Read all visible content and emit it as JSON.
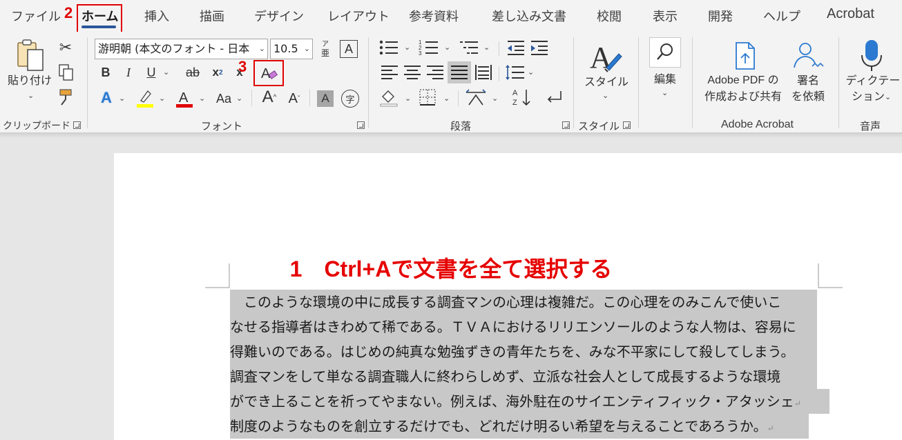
{
  "tabs": [
    "ファイル",
    "ホーム",
    "挿入",
    "描画",
    "デザイン",
    "レイアウト",
    "参考資料",
    "差し込み文書",
    "校閲",
    "表示",
    "開発",
    "ヘルプ",
    "Acrobat"
  ],
  "annotations": {
    "step1": "1　Ctrl+Aで文書を全て選択する",
    "step2": "2",
    "step3": "3"
  },
  "clipboard": {
    "paste_label": "貼り付け",
    "group_label": "クリップボード"
  },
  "font": {
    "name_value": "游明朝 (本文のフォント - 日本",
    "size_value": "10.5",
    "bold": "B",
    "italic": "I",
    "underline": "U",
    "strike": "ab",
    "subscript": "x",
    "superscript": "x",
    "change_case": "Aa",
    "grow": "A",
    "shrink": "A",
    "group_label": "フォント",
    "phonetic_top": "ア",
    "phonetic_bottom": "亜",
    "enclose": "字"
  },
  "paragraph": {
    "group_label": "段落"
  },
  "styles": {
    "label": "スタイル",
    "group_label": "スタイル"
  },
  "editing": {
    "label": "編集"
  },
  "acrobat": {
    "create_share_line1": "Adobe PDF の",
    "create_share_line2": "作成および共有",
    "sign_line1": "署名",
    "sign_line2": "を依頼",
    "group_label": "Adobe Acrobat"
  },
  "voice": {
    "dictate_line1": "ディクテー",
    "dictate_line2": "ション",
    "group_label": "音声"
  },
  "document": {
    "lines": [
      "　このような環境の中に成長する調査マンの心理は複雑だ。この心理をのみこんで使いこ",
      "なせる指導者はきわめて稀である。ＴＶＡにおけるリリエンソールのような人物は、容易に",
      "得難いのである。はじめの純真な勉強ずきの青年たちを、みな不平家にして殺してしまう。",
      "調査マンをして単なる調査職人に終わらしめず、立派な社会人として成長するような環境",
      "ができ上ることを祈ってやまない。例えば、海外駐在のサイエンティフィック・アタッシェ",
      "制度のようなものを創立するだけでも、どれだけ明るい希望を与えることであろうか。"
    ],
    "paragraph_mark": "↵"
  },
  "colors": {
    "accent": "#2b579a",
    "annotation_red": "#e00000",
    "selection": "#c8c8c8"
  }
}
